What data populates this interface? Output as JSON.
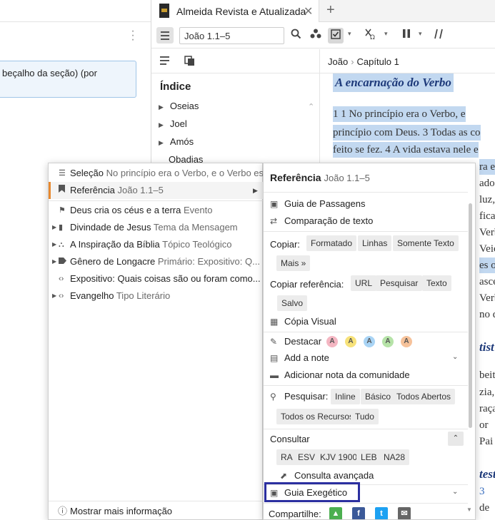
{
  "left_panel": {
    "section_text": "beçalho da seção) (por"
  },
  "tab": {
    "title": "Almeida Revista e Atualizada",
    "close": "✕",
    "add": "+"
  },
  "toolbar": {
    "reference_value": "João 1.1–5"
  },
  "breadcrumb": {
    "book": "João",
    "separator": "›",
    "chapter": "Capítulo 1"
  },
  "index": {
    "title": "Índice",
    "items": [
      "Oseias",
      "Joel",
      "Amós",
      "Obadias"
    ]
  },
  "text": {
    "heading": "A encarnação do Verbo",
    "line1": "1  1 No princípio era o Verbo, e",
    "line2": "princípio com Deus. 3 Todas as co",
    "line3": "feito se fez. 4 A vida estava nele e",
    "frags": [
      "ra e",
      "ado",
      "luz,",
      "fica",
      "Verb",
      "Veic",
      "es o",
      "asce",
      "Verb",
      "no d",
      "tist",
      "beito",
      "zia,",
      "raça",
      "or",
      "Pai",
      "test",
      "3",
      "de"
    ]
  },
  "context_left": {
    "items": [
      {
        "label": "Seleção",
        "sub": "No princípio era o Verbo, e o Verbo estava com Deus"
      },
      {
        "label": "Referência",
        "sub": "João 1.1–5"
      },
      {
        "label": "Deus cria os céus e a terra",
        "sub": "Evento"
      },
      {
        "label": "Divindade de Jesus",
        "sub": "Tema da Mensagem"
      },
      {
        "label": "A Inspiração da Bíblia",
        "sub": "Tópico Teológico"
      },
      {
        "label": "Gênero de Longacre",
        "sub": "Primário: Expositivo: Q..."
      },
      {
        "label": "Expositivo: Quais coisas são ou foram como...",
        "sub": ""
      },
      {
        "label": "Evangelho",
        "sub": "Tipo Literário"
      }
    ],
    "more_info": "Mostrar mais informação"
  },
  "context_right": {
    "title": "Referência",
    "title_sub": "João 1.1–5",
    "passage_guide": "Guia de Passagens",
    "text_comparison": "Comparação de texto",
    "copy_label": "Copiar:",
    "copy_chips": [
      "Formatado",
      "Linhas",
      "Somente Texto",
      "Mais »"
    ],
    "copy_ref_label": "Copiar referência:",
    "copy_ref_chips": [
      "URL",
      "Pesquisar",
      "Texto",
      "Salvo"
    ],
    "visual_copy": "Cópia Visual",
    "highlight_label": "Destacar",
    "highlight_letter": "A",
    "highlight_colors": [
      "#f4b6c2",
      "#f7e27a",
      "#a9d4f5",
      "#b6e3a8",
      "#f6c29a"
    ],
    "add_note": "Add a note",
    "community_note": "Adicionar nota da comunidade",
    "search_label": "Pesquisar:",
    "search_chips": [
      "Inline",
      "Básico",
      "Todos Abertos",
      "Todos os Recursos",
      "Tudo"
    ],
    "consult_label": "Consultar",
    "consult_chips": [
      "RA",
      "ESV",
      "KJV 1900",
      "LEB",
      "NA28"
    ],
    "advanced_consult": "Consulta avançada",
    "exegetical_guide": "Guia Exegético",
    "share_label": "Compartilhe:"
  }
}
